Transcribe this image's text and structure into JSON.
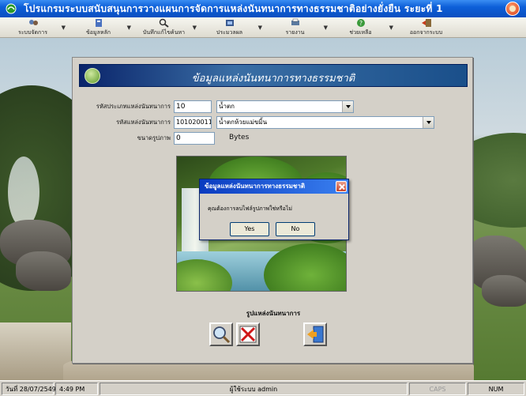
{
  "window": {
    "title": "โปรแกรมระบบสนับสนุนการวางแผนการจัดการแหล่งนันทนาการทางธรรมชาติอย่างยั่งยืน ระยะที่ 1"
  },
  "menu": [
    {
      "label": "ระบบจัดการ",
      "icon": "manage-icon"
    },
    {
      "label": "ข้อมูลหลัก",
      "icon": "database-icon"
    },
    {
      "label": "บันทึกแก้ไขค้นหา",
      "icon": "edit-search-icon"
    },
    {
      "label": "ประมวลผล",
      "icon": "process-icon"
    },
    {
      "label": "รายงาน",
      "icon": "report-icon"
    },
    {
      "label": "ช่วยเหลือ",
      "icon": "help-icon"
    },
    {
      "label": "ออกจากระบบ",
      "icon": "logout-icon"
    }
  ],
  "form": {
    "header": "ข้อมูลแหล่งนันทนาการทางธรรมชาติ",
    "type_code_label": "รหัสประเภทแหล่งนันทนาการ",
    "type_code_value": "10",
    "type_name_value": "น้ำตก",
    "site_code_label": "รหัสแหล่งนันทนาการ",
    "site_code_value": "101020011",
    "site_name_value": "น้ำตกห้วยแม่ขมิ้น",
    "image_size_label": "ขนาดรูปภาพ",
    "image_size_value": "0",
    "image_size_unit": "Bytes",
    "picture_caption": "รูปแหล่งนันทนาการ"
  },
  "dialog": {
    "title": "ข้อมูลแหล่งนันทนาการทางธรรมชาติ",
    "message": "คุณต้องการลบไฟล์รูปภาพใช่หรือไม่",
    "yes_label": "Yes",
    "no_label": "No"
  },
  "statusbar": {
    "date": "วันที่ 28/07/2549",
    "time": "4:49 PM",
    "user": "ผู้ใช้ระบบ admin",
    "caps": "CAPS",
    "num": "NUM"
  },
  "colors": {
    "titlebar": "#0d5fd8",
    "header": "#0a246a",
    "delete_red": "#d01818"
  }
}
